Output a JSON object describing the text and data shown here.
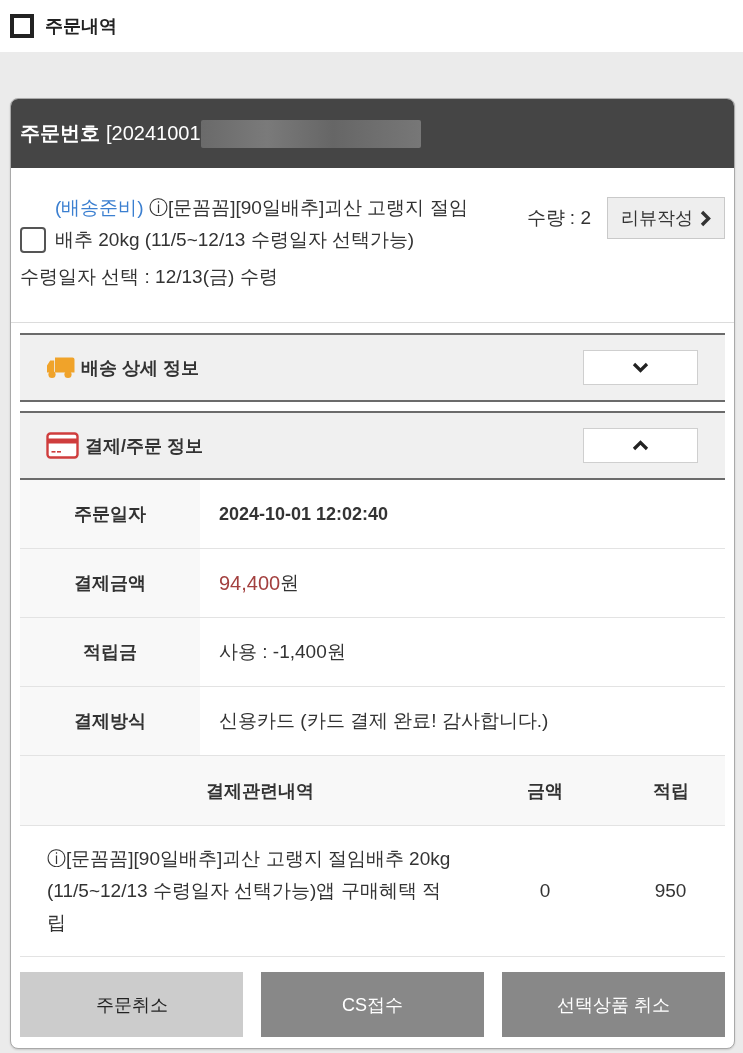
{
  "header": {
    "title": "주문내역"
  },
  "order": {
    "number_label": "주문번호",
    "number_value": "[20241001",
    "number_redacted": true,
    "item": {
      "status": "(배송준비)",
      "name": "ⓘ[문꼼꼼][90일배추]괴산 고랭지 절임배추 20kg (11/5~12/13 수령일자 선택가능)",
      "checked": false,
      "pickup": "수령일자 선택 : 12/13(금) 수령",
      "quantity": "수량 : 2",
      "review_button": "리뷰작성"
    },
    "sections": [
      {
        "kind": "delivery",
        "title": "배송 상세 정보",
        "expanded": false
      },
      {
        "kind": "payment",
        "title": "결제/주문 정보",
        "expanded": true,
        "details": [
          {
            "label": "주문일자",
            "kind": "bold",
            "value": "2024-10-01 12:02:40"
          },
          {
            "label": "결제금액",
            "kind": "price",
            "value": "94,400",
            "unit": "원"
          },
          {
            "label": "적립금",
            "kind": "plain",
            "value": "사용 : -1,400원"
          },
          {
            "label": "결제방식",
            "kind": "plain",
            "value": "신용카드 (카드 결제 완료! 감사합니다.)"
          }
        ],
        "history": {
          "columns": [
            "결제관련내역",
            "금액",
            "적립"
          ],
          "rows": [
            [
              "ⓘ[문꼼꼼][90일배추]괴산 고랭지 절임배추 20kg (11/5~12/13 수령일자 선택가능)앱 구매혜택 적립",
              "0",
              "950"
            ]
          ]
        }
      }
    ],
    "buttons": [
      {
        "label": "주문취소",
        "kind": "light"
      },
      {
        "label": "CS접수",
        "kind": "dark"
      },
      {
        "label": "선택상품 취소",
        "kind": "dark"
      }
    ]
  }
}
